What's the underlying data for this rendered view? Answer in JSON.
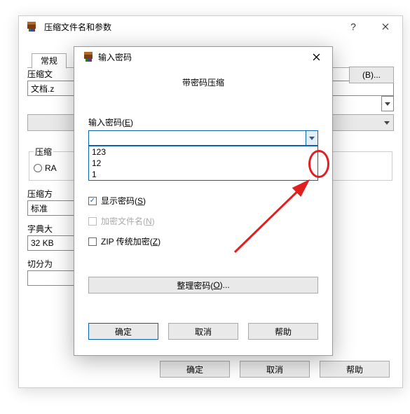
{
  "back_dialog": {
    "title": "压缩文件名和参数",
    "help_icon": "?",
    "tab": "常规",
    "filename_label": "压缩文",
    "filename_value": "文档.z",
    "browse_btn": "(B)...",
    "format_label": "压缩",
    "format_radio": "RA",
    "method_label": "压缩方",
    "method_value": "标准",
    "dict_label": "字典大",
    "dict_value": "32 KB",
    "split_label": "切分为",
    "split_value": "",
    "buttons": {
      "ok": "确定",
      "cancel": "取消",
      "help": "帮助"
    }
  },
  "front_dialog": {
    "title": "输入密码",
    "section": "带密码压缩",
    "password_label_prefix": "输入密码(",
    "password_label_hotkey": "E",
    "password_label_suffix": ")",
    "password_value": "",
    "dropdown_items": [
      "123",
      "12",
      "1"
    ],
    "show_pw_prefix": "显示密码(",
    "show_pw_hotkey": "S",
    "show_pw_suffix": ")",
    "encrypt_names_prefix": "加密文件名(",
    "encrypt_names_hotkey": "N",
    "encrypt_names_suffix": ")",
    "zip_legacy_prefix": "ZIP 传统加密(",
    "zip_legacy_hotkey": "Z",
    "zip_legacy_suffix": ")",
    "manage_prefix": "整理密码(",
    "manage_hotkey": "O",
    "manage_suffix": ")...",
    "buttons": {
      "ok": "确定",
      "cancel": "取消",
      "help": "帮助"
    }
  }
}
